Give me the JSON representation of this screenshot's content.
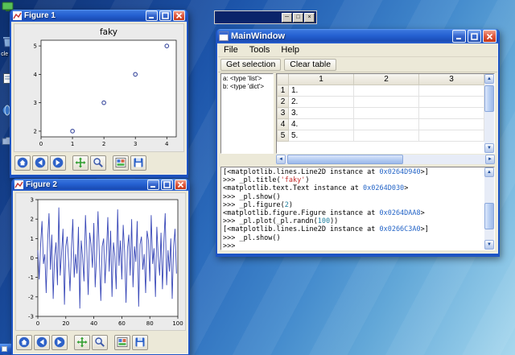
{
  "desktop": {
    "icon_labels": [
      "",
      "cle B",
      "",
      "",
      ""
    ]
  },
  "background_window": {
    "buttons": [
      "minimize",
      "maximize",
      "close"
    ]
  },
  "main_window": {
    "title": "MainWindow",
    "menu": [
      "File",
      "Tools",
      "Help"
    ],
    "toolbar": [
      "Get selection",
      "Clear table"
    ],
    "variables": [
      "a: <type 'list'>",
      "b: <type 'dict'>"
    ],
    "table": {
      "col_headers": [
        "1",
        "2",
        "3"
      ],
      "row_headers": [
        "1",
        "2",
        "3",
        "4",
        "5"
      ],
      "cells": [
        [
          "1.",
          "",
          ""
        ],
        [
          "2.",
          "",
          ""
        ],
        [
          "3.",
          "",
          ""
        ],
        [
          "4.",
          "",
          ""
        ],
        [
          "5.",
          "",
          ""
        ]
      ]
    },
    "console": {
      "colors": {
        "addr": "#2565c7",
        "str": "#c22a2a",
        "num": "#2080a0"
      },
      "lines": [
        [
          {
            "t": "[<matplotlib.lines.Line2D instance at "
          },
          {
            "t": "0x0264D940",
            "c": "addr"
          },
          {
            "t": ">]"
          }
        ],
        [
          {
            "t": ">>> _pl.title("
          },
          {
            "t": "'faky'",
            "c": "str"
          },
          {
            "t": ")"
          }
        ],
        [
          {
            "t": "<matplotlib.text.Text instance at "
          },
          {
            "t": "0x0264D030",
            "c": "addr"
          },
          {
            "t": ">"
          }
        ],
        [
          {
            "t": ">>> _pl.show()"
          }
        ],
        [
          {
            "t": ">>> _pl.figure("
          },
          {
            "t": "2",
            "c": "num"
          },
          {
            "t": ")"
          }
        ],
        [
          {
            "t": "<matplotlib.figure.Figure instance at "
          },
          {
            "t": "0x0264DAA8",
            "c": "addr"
          },
          {
            "t": ">"
          }
        ],
        [
          {
            "t": ">>> _pl.plot(_pl.randn("
          },
          {
            "t": "100",
            "c": "num"
          },
          {
            "t": "))"
          }
        ],
        [
          {
            "t": "[<matplotlib.lines.Line2D instance at "
          },
          {
            "t": "0x0266C3A0",
            "c": "addr"
          },
          {
            "t": ">]"
          }
        ],
        [
          {
            "t": ">>> _pl.show()"
          }
        ],
        [
          {
            "t": ">>>"
          }
        ]
      ]
    }
  },
  "figure1": {
    "title": "Figure 1"
  },
  "figure2": {
    "title": "Figure 2"
  },
  "figure_toolbar": {
    "icons": [
      "home",
      "back",
      "forward",
      "pan",
      "zoom",
      "subplots",
      "save"
    ]
  },
  "chart_data": [
    {
      "id": "figure1",
      "type": "scatter",
      "title": "faky",
      "x": [
        1,
        2,
        3,
        4
      ],
      "y": [
        2,
        3,
        4,
        5
      ],
      "xlim": [
        0,
        4.3
      ],
      "ylim": [
        1.8,
        5.2
      ],
      "xticks": [
        0,
        1,
        2,
        3,
        4
      ],
      "yticks": [
        2,
        3,
        4,
        5
      ],
      "xlabel": "",
      "ylabel": "",
      "grid": false,
      "legend": "none"
    },
    {
      "id": "figure2",
      "type": "line",
      "title": "",
      "y": [
        0.4,
        -1.1,
        0.7,
        1.9,
        -0.3,
        0.2,
        -1.8,
        0.9,
        2.3,
        -0.6,
        1.2,
        -2.1,
        0.1,
        0.8,
        -1.4,
        2.6,
        -0.9,
        0.3,
        1.5,
        -2.4,
        0.6,
        1.1,
        -0.2,
        -1.7,
        0.5,
        2.0,
        -1.0,
        0.2,
        -0.8,
        1.6,
        -2.6,
        0.9,
        0.0,
        -1.2,
        2.2,
        0.4,
        -1.9,
        1.3,
        0.7,
        -0.5,
        1.8,
        -1.5,
        0.2,
        2.4,
        -0.1,
        -2.2,
        0.6,
        1.0,
        -1.3,
        0.3,
        2.1,
        -0.7,
        1.4,
        -2.0,
        0.8,
        0.1,
        -1.6,
        2.5,
        -0.4,
        0.9,
        -1.1,
        1.7,
        0.3,
        -2.3,
        0.5,
        1.2,
        -0.9,
        2.0,
        -1.5,
        0.6,
        -0.2,
        1.9,
        -2.5,
        0.7,
        1.1,
        -0.6,
        0.2,
        -1.8,
        1.4,
        0.9,
        -1.2,
        2.2,
        -0.3,
        0.5,
        -2.0,
        1.6,
        0.1,
        -0.9,
        1.3,
        -1.6,
        0.8,
        2.3,
        -1.4,
        0.4,
        -0.7,
        1.0,
        -2.1,
        0.6,
        1.5,
        -0.8
      ],
      "xlim": [
        0,
        100
      ],
      "ylim": [
        -3,
        3
      ],
      "xticks": [
        0,
        20,
        40,
        60,
        80,
        100
      ],
      "yticks": [
        -3,
        -2,
        -1,
        0,
        1,
        2,
        3
      ],
      "xlabel": "",
      "ylabel": "",
      "grid": false,
      "legend": "none"
    }
  ]
}
